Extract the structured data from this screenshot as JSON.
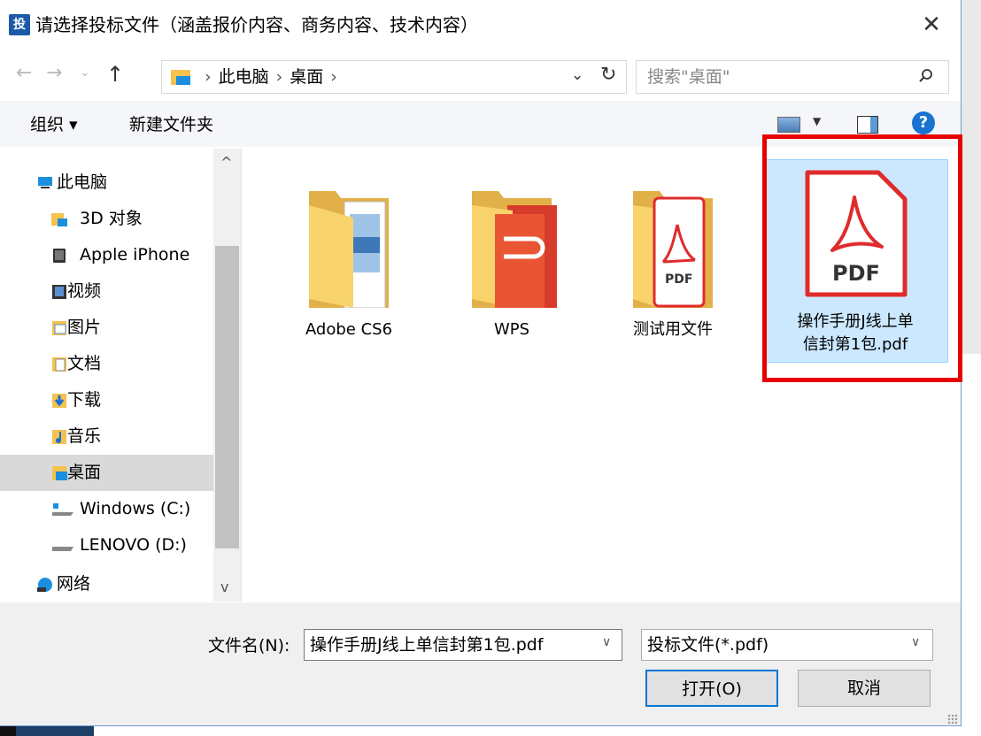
{
  "title": "请选择投标文件（涵盖报价内容、商务内容、技术内容）",
  "app_icon_text": "投",
  "close_glyph": "✕",
  "nav": {
    "back": "←",
    "forward": "→",
    "recent": "⌄",
    "up": "↑",
    "path": [
      "此电脑",
      "桌面"
    ],
    "path_sep": "›",
    "dropdown": "⌄",
    "refresh": "↻"
  },
  "search": {
    "placeholder": "搜索\"桌面\""
  },
  "toolbar": {
    "organize": "组织 ▾",
    "new_folder": "新建文件夹",
    "help": "?"
  },
  "sidebar": {
    "items": [
      {
        "label": "此电脑",
        "icon": "computer-icon",
        "selected": false
      },
      {
        "label": "3D 对象",
        "icon": "3d-objects-icon",
        "selected": false
      },
      {
        "label": "Apple iPhone",
        "icon": "phone-icon",
        "selected": false
      },
      {
        "label": "视频",
        "icon": "video-icon",
        "selected": false
      },
      {
        "label": "图片",
        "icon": "pictures-icon",
        "selected": false
      },
      {
        "label": "文档",
        "icon": "documents-icon",
        "selected": false
      },
      {
        "label": "下载",
        "icon": "downloads-icon",
        "selected": false
      },
      {
        "label": "音乐",
        "icon": "music-icon",
        "selected": false
      },
      {
        "label": "桌面",
        "icon": "desktop-icon",
        "selected": true
      },
      {
        "label": "Windows (C:)",
        "icon": "drive-icon",
        "selected": false
      },
      {
        "label": "LENOVO (D:)",
        "icon": "drive-icon",
        "selected": false
      },
      {
        "label": "网络",
        "icon": "network-icon",
        "selected": false
      }
    ]
  },
  "files": [
    {
      "name": "Adobe CS6",
      "type": "folder"
    },
    {
      "name": "WPS",
      "type": "folder"
    },
    {
      "name": "测试用文件",
      "type": "folder"
    },
    {
      "name_line1": "操作手册J线上单",
      "name_line2": "信封第1包.pdf",
      "type": "pdf",
      "badge": "PDF",
      "selected": true
    }
  ],
  "footer": {
    "filename_label": "文件名(N):",
    "filename_value": "操作手册J线上单信封第1包.pdf",
    "filetype_value": "投标文件(*.pdf)",
    "open_label": "打开(O)",
    "cancel_label": "取消"
  },
  "colors": {
    "accent": "#0078d7",
    "selection": "#cce8ff",
    "highlight_box": "#e60000",
    "pdf_red": "#e02b2b"
  }
}
